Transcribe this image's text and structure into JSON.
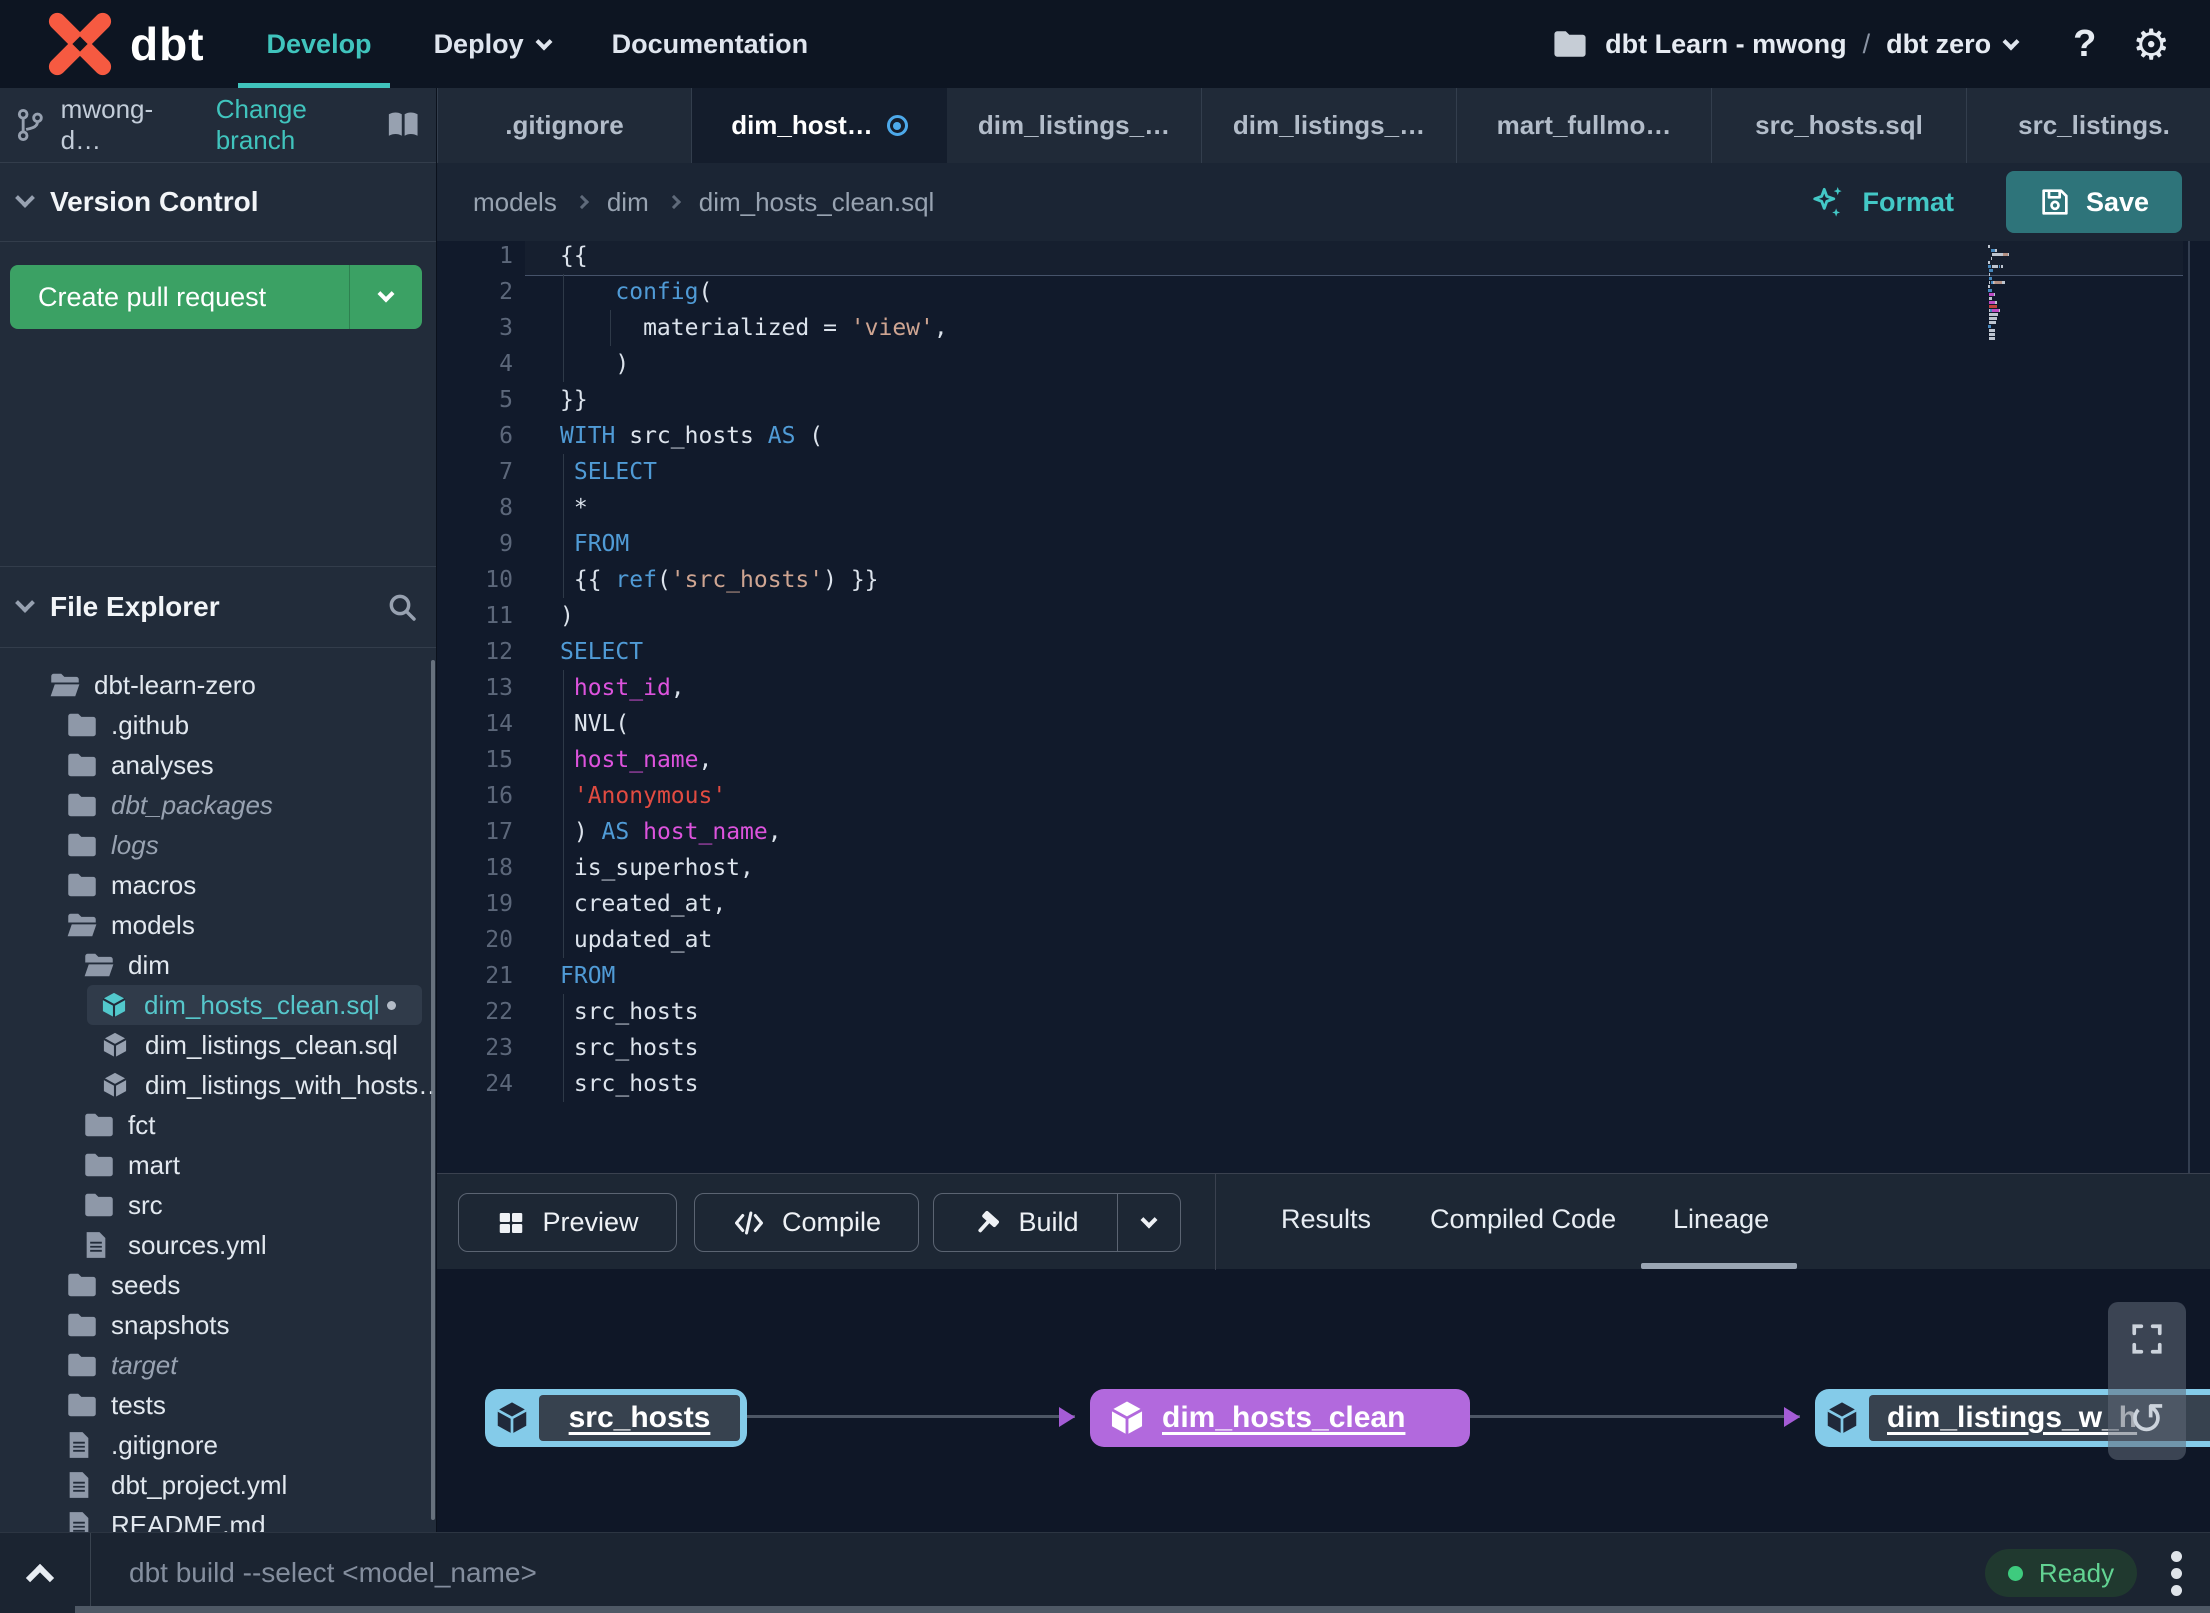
{
  "colors": {
    "accent_teal": "#40c4bd",
    "brand_orange": "#f65a41",
    "green_button": "#3ba164",
    "node_purple": "#b269dd",
    "node_cyan": "#84cbe9",
    "status_green": "#62d392",
    "code_keyword": "#509bd6",
    "code_string": "#cfa592",
    "code_string_red": "#e14b41",
    "code_column": "#dd53dd",
    "code_default": "#dce3ec"
  },
  "topnav": {
    "brand": "dbt",
    "items": [
      {
        "label": "Develop",
        "active": true
      },
      {
        "label": "Deploy",
        "dropdown": true
      },
      {
        "label": "Documentation"
      }
    ],
    "account": "dbt Learn - mwong",
    "separator": "/",
    "project": "dbt zero",
    "help": "?"
  },
  "sidebar": {
    "branch": {
      "name": "mwong-d…",
      "action": "Change branch"
    },
    "version_control": {
      "title": "Version Control",
      "create_pr": "Create pull request"
    },
    "file_explorer": {
      "title": "File Explorer",
      "tree": [
        {
          "name": "dbt-learn-zero",
          "icon": "folder-open",
          "level": 0
        },
        {
          "name": ".github",
          "icon": "folder",
          "level": 1
        },
        {
          "name": "analyses",
          "icon": "folder",
          "level": 1
        },
        {
          "name": "dbt_packages",
          "icon": "folder",
          "level": 1,
          "muted": true
        },
        {
          "name": "logs",
          "icon": "folder",
          "level": 1,
          "muted": true
        },
        {
          "name": "macros",
          "icon": "folder",
          "level": 1
        },
        {
          "name": "models",
          "icon": "folder-open",
          "level": 1
        },
        {
          "name": "dim",
          "icon": "folder-open",
          "level": 2
        },
        {
          "name": "dim_hosts_clean.sql",
          "icon": "model",
          "level": 3,
          "selected": true,
          "modified": true
        },
        {
          "name": "dim_listings_clean.sql",
          "icon": "model",
          "level": 3
        },
        {
          "name": "dim_listings_with_hosts…",
          "icon": "model",
          "level": 3
        },
        {
          "name": "fct",
          "icon": "folder",
          "level": 2
        },
        {
          "name": "mart",
          "icon": "folder",
          "level": 2
        },
        {
          "name": "src",
          "icon": "folder",
          "level": 2
        },
        {
          "name": "sources.yml",
          "icon": "file",
          "level": 2
        },
        {
          "name": "seeds",
          "icon": "folder",
          "level": 1
        },
        {
          "name": "snapshots",
          "icon": "folder",
          "level": 1
        },
        {
          "name": "target",
          "icon": "folder",
          "level": 1,
          "muted": true
        },
        {
          "name": "tests",
          "icon": "folder",
          "level": 1
        },
        {
          "name": ".gitignore",
          "icon": "file",
          "level": 1
        },
        {
          "name": "dbt_project.yml",
          "icon": "file",
          "level": 1
        },
        {
          "name": "README.md",
          "icon": "file",
          "level": 1
        }
      ]
    }
  },
  "tabs": {
    "items": [
      {
        "label": ".gitignore"
      },
      {
        "label": "dim_host…",
        "active": true,
        "modified": true
      },
      {
        "label": "dim_listings_…"
      },
      {
        "label": "dim_listings_…"
      },
      {
        "label": "mart_fullmo…"
      },
      {
        "label": "src_hosts.sql"
      },
      {
        "label": "src_listings."
      }
    ],
    "add": "+"
  },
  "breadcrumb": {
    "path": [
      "models",
      "dim",
      "dim_hosts_clean.sql"
    ],
    "format": "Format",
    "save": "Save"
  },
  "editor": {
    "lines": [
      [
        [
          "{{",
          "d"
        ]
      ],
      [
        [
          "    ",
          "d"
        ],
        [
          "config",
          "kw"
        ],
        [
          "(",
          "d"
        ]
      ],
      [
        [
          "      materialized = ",
          "d"
        ],
        [
          "'view'",
          "str"
        ],
        [
          ",",
          "d"
        ]
      ],
      [
        [
          "    )",
          "d"
        ]
      ],
      [
        [
          "}}",
          "d"
        ]
      ],
      [
        [
          "WITH",
          "kw"
        ],
        [
          " src_hosts ",
          "d"
        ],
        [
          "AS",
          "kw"
        ],
        [
          " (",
          "d"
        ]
      ],
      [
        [
          " ",
          "d"
        ],
        [
          "SELECT",
          "kw"
        ]
      ],
      [
        [
          " *",
          "d"
        ]
      ],
      [
        [
          " ",
          "d"
        ],
        [
          "FROM",
          "kw"
        ]
      ],
      [
        [
          " {{ ",
          "d"
        ],
        [
          "ref",
          "kw"
        ],
        [
          "(",
          "d"
        ],
        [
          "'src_hosts'",
          "str"
        ],
        [
          ") }}",
          "d"
        ]
      ],
      [
        [
          ")",
          "d"
        ]
      ],
      [
        [
          "SELECT",
          "kw"
        ]
      ],
      [
        [
          " ",
          "d"
        ],
        [
          "host_id",
          "col"
        ],
        [
          ",",
          "d"
        ]
      ],
      [
        [
          " NVL(",
          "d"
        ]
      ],
      [
        [
          " ",
          "d"
        ],
        [
          "host_name",
          "col"
        ],
        [
          ",",
          "d"
        ]
      ],
      [
        [
          " ",
          "d"
        ],
        [
          "'Anonymous'",
          "str2"
        ]
      ],
      [
        [
          " ) ",
          "d"
        ],
        [
          "AS",
          "kw"
        ],
        [
          " ",
          "d"
        ],
        [
          "host_name",
          "col"
        ],
        [
          ",",
          "d"
        ]
      ],
      [
        [
          " is_superhost,",
          "d"
        ]
      ],
      [
        [
          " created_at,",
          "d"
        ]
      ],
      [
        [
          " updated_at",
          "d"
        ]
      ],
      [
        [
          "FROM",
          "kw"
        ]
      ],
      [
        [
          " src_hosts",
          "d"
        ]
      ],
      [
        [
          " src_hosts",
          "d"
        ]
      ],
      [
        [
          " src_hosts",
          "d"
        ]
      ]
    ]
  },
  "bottom_panel": {
    "preview": "Preview",
    "compile": "Compile",
    "build": "Build",
    "tabs": [
      {
        "label": "Results"
      },
      {
        "label": "Compiled Code"
      },
      {
        "label": "Lineage",
        "active": true
      }
    ]
  },
  "lineage": {
    "nodes": [
      {
        "label": "src_hosts",
        "style": "cyan"
      },
      {
        "label": "dim_hosts_clean",
        "style": "purple"
      },
      {
        "label": "dim_listings_w_h",
        "style": "cyan"
      }
    ]
  },
  "command_bar": {
    "placeholder": "dbt build --select <model_name>",
    "status": "Ready"
  }
}
